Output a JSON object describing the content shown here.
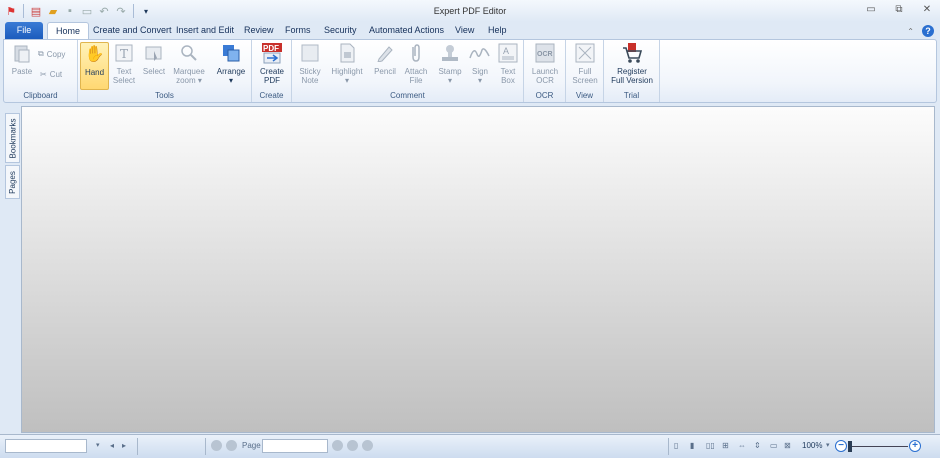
{
  "window": {
    "title": "Expert PDF Editor"
  },
  "tabs": [
    "File",
    "Home",
    "Create and Convert",
    "Insert and Edit",
    "Review",
    "Forms",
    "Security",
    "Automated Actions",
    "View",
    "Help"
  ],
  "ribbon": {
    "clipboard": {
      "label": "Clipboard",
      "paste": "Paste",
      "copy": "Copy",
      "cut": "Cut"
    },
    "tools": {
      "label": "Tools",
      "hand": "Hand",
      "text_select": [
        "Text",
        "Select"
      ],
      "select": "Select",
      "marquee_zoom": [
        "Marquee",
        "zoom ▾"
      ],
      "arrange": [
        "Arrange",
        "▾"
      ]
    },
    "create": {
      "label": "Create",
      "create_pdf": [
        "Create",
        "PDF"
      ]
    },
    "comment": {
      "label": "Comment",
      "sticky_note": [
        "Sticky",
        "Note"
      ],
      "highlight": [
        "Highlight",
        "▾"
      ],
      "pencil": "Pencil",
      "attach_file": [
        "Attach",
        "File"
      ],
      "stamp": [
        "Stamp",
        "▾"
      ],
      "sign": [
        "Sign",
        "▾"
      ],
      "text_box": [
        "Text",
        "Box"
      ]
    },
    "ocr": {
      "label": "OCR",
      "launch_ocr": [
        "Launch",
        "OCR"
      ]
    },
    "view": {
      "label": "View",
      "full_screen": [
        "Full",
        "Screen"
      ]
    },
    "trial": {
      "label": "Trial",
      "register": [
        "Register",
        "Full Version"
      ]
    }
  },
  "sidepanel": {
    "bookmarks": "Bookmarks",
    "pages": "Pages"
  },
  "statusbar": {
    "page_label": "Page",
    "zoom": "100%"
  },
  "colors": {
    "accent": "#1c5cbd",
    "highlight": "#ffd872"
  }
}
